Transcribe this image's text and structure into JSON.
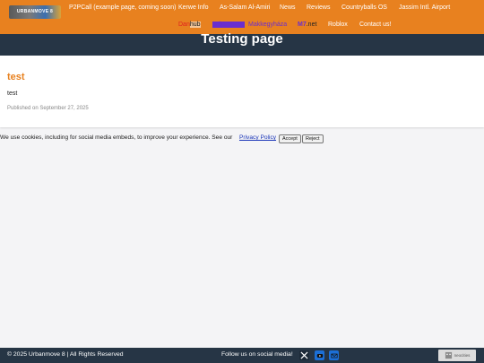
{
  "header": {
    "logo_text": "URBANMOVE 8",
    "nav_row1": [
      "P2PCall (example page, coming soon)",
      "Kerwe Info",
      "As-Salam Al-Amiri",
      "News",
      "Reviews",
      "Countryballs OS",
      "Jassim Intl. Airport"
    ],
    "danhub_dan": "Dan",
    "danhub_hub": "hub",
    "highlighted_item": "Urbanmove",
    "nav_row2": [
      "Makkegyháza",
      "M7",
      ".net",
      "Roblox",
      "Contact us!"
    ]
  },
  "hero": {
    "title": "Testing page"
  },
  "post": {
    "title": "test",
    "body": "test",
    "published": "Published on September 27, 2025"
  },
  "cookie": {
    "text": "We use cookies, including for social media embeds, to improve your experience. See our",
    "link": "Privacy Policy",
    "accept": "Accept",
    "reject": "Reject"
  },
  "footer": {
    "copyright": "© 2025 Urbanmove 8 | All Rights Reserved",
    "follow": "Follow us on social media!",
    "social_icons": [
      "x-icon",
      "youtube-icon",
      "mail-icon"
    ],
    "badge": "neocities"
  },
  "colors": {
    "header": "#e8811f",
    "dark": "#263545",
    "accent": "#e8811f",
    "link": "#1a35b8"
  }
}
